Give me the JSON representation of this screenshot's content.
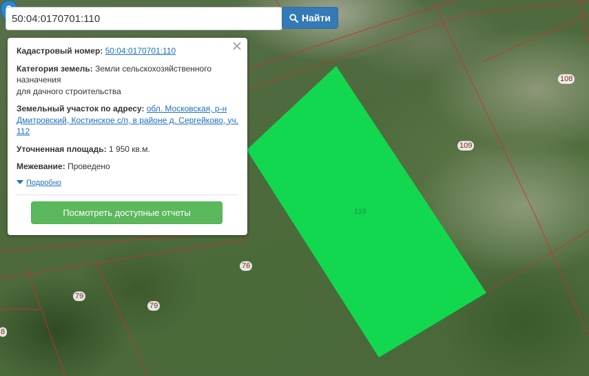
{
  "search": {
    "value": "50:04:0170701:110",
    "button_label": "Найти"
  },
  "info": {
    "cadastral_label": "Кадастровый номер:",
    "cadastral_value": "50:04:0170701:110",
    "category_label": "Категория земель:",
    "category_value_line1": "Земли сельскохозяйственного назначения",
    "category_value_line2": "для дачного строительства",
    "address_label": "Земельный участок по адресу:",
    "address_value": "обл. Московская, р-н Дмитровский, Костинское с/п, в районе д. Сергейково, уч. 112",
    "area_label": "Уточненная площадь:",
    "area_value": "1 950 кв.м.",
    "survey_label": "Межевание:",
    "survey_value": "Проведено",
    "details_label": "Подробно",
    "report_button": "Посмотреть доступные отчеты"
  },
  "map": {
    "selected_label": "110",
    "plot_labels": [
      "108",
      "109",
      "76",
      "79",
      "79",
      "8"
    ],
    "selection_color": "#11dc4f",
    "boundary_color": "#c83232"
  },
  "icons": {
    "search": "search-icon",
    "close": "close-icon",
    "caret": "caret-down-icon",
    "marker": "map-marker-icon"
  }
}
